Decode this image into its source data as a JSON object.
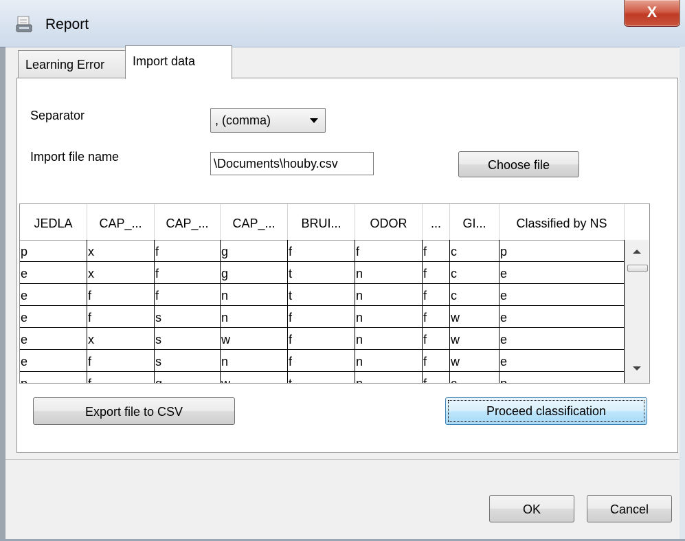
{
  "window": {
    "title": "Report",
    "close_label": "X"
  },
  "tabs": [
    {
      "label": "Learning Error",
      "active": false
    },
    {
      "label": "Import data",
      "active": true
    }
  ],
  "form": {
    "separator_label": "Separator",
    "separator_value": ", (comma)",
    "file_label": "Import file name",
    "file_value": "\\Documents\\houby.csv",
    "choose_label": "Choose file"
  },
  "table": {
    "columns": [
      "JEDLA",
      "CAP_...",
      "CAP_...",
      "CAP_...",
      "BRUI...",
      "ODOR",
      "...",
      "GI...",
      "Classified by NS"
    ],
    "rows": [
      [
        "p",
        "x",
        "f",
        "g",
        "f",
        "f",
        "f",
        "c",
        "p"
      ],
      [
        "e",
        "x",
        "f",
        "g",
        "t",
        "n",
        "f",
        "c",
        "e"
      ],
      [
        "e",
        "f",
        "f",
        "n",
        "t",
        "n",
        "f",
        "c",
        "e"
      ],
      [
        "e",
        "f",
        "s",
        "n",
        "f",
        "n",
        "f",
        "w",
        "e"
      ],
      [
        "e",
        "x",
        "s",
        "w",
        "f",
        "n",
        "f",
        "w",
        "e"
      ],
      [
        "e",
        "f",
        "s",
        "n",
        "f",
        "n",
        "f",
        "w",
        "e"
      ],
      [
        "p",
        "f",
        "g",
        "w",
        "t",
        "n",
        "f",
        "c",
        "p"
      ]
    ]
  },
  "buttons": {
    "export_label": "Export file to CSV",
    "proceed_label": "Proceed classification",
    "ok_label": "OK",
    "cancel_label": "Cancel"
  }
}
